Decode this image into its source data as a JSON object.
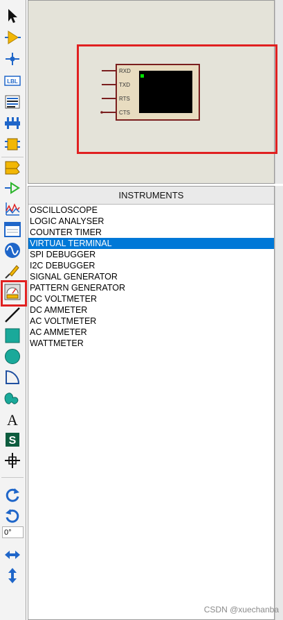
{
  "toolbar": {
    "tools": [
      {
        "name": "selection-tool",
        "icon": "arrow-pointer-icon"
      },
      {
        "name": "component-tool",
        "icon": "component-triangle-icon"
      },
      {
        "name": "junction-dot-tool",
        "icon": "junction-cross-icon"
      },
      {
        "name": "wire-label-tool",
        "icon": "lbl-icon",
        "label": "LBL"
      },
      {
        "name": "text-script-tool",
        "icon": "text-lines-icon"
      },
      {
        "name": "buses-tool",
        "icon": "bus-icon"
      },
      {
        "name": "subcircuit-tool",
        "icon": "subcircuit-icon"
      },
      {
        "name": "terminals-tool",
        "icon": "terminal-icon"
      },
      {
        "name": "device-pins-tool",
        "icon": "pin-icon"
      },
      {
        "name": "graph-tool",
        "icon": "graph-icon"
      },
      {
        "name": "tape-recorder-tool",
        "icon": "tape-icon"
      },
      {
        "name": "generator-tool",
        "icon": "sine-wave-icon"
      },
      {
        "name": "voltage-probe-tool",
        "icon": "probe-icon"
      },
      {
        "name": "virtual-instruments-tool",
        "icon": "meter-gauge-icon"
      },
      {
        "name": "line-tool",
        "icon": "line-icon"
      },
      {
        "name": "box-tool",
        "icon": "box-icon"
      },
      {
        "name": "circle-tool",
        "icon": "circle-icon"
      },
      {
        "name": "arc-tool",
        "icon": "arc-icon"
      },
      {
        "name": "closed-path-tool",
        "icon": "path-icon"
      },
      {
        "name": "text-tool",
        "icon": "text-a-icon",
        "label": "A"
      },
      {
        "name": "symbol-tool",
        "icon": "symbol-s-icon",
        "label": "S"
      },
      {
        "name": "marker-tool",
        "icon": "marker-icon"
      },
      {
        "name": "rotate-clockwise-tool",
        "icon": "rotate-cw-icon"
      },
      {
        "name": "rotate-anticlockwise-tool",
        "icon": "rotate-ccw-icon"
      },
      {
        "name": "mirror-horizontal-tool",
        "icon": "flip-horizontal-icon"
      },
      {
        "name": "mirror-vertical-tool",
        "icon": "flip-vertical-icon"
      }
    ],
    "rotation_value": "0°"
  },
  "preview": {
    "component": "VIRTUAL TERMINAL",
    "pins": [
      "RXD",
      "TXD",
      "RTS",
      "CTS"
    ]
  },
  "instruments": {
    "header": "INSTRUMENTS",
    "items": [
      "OSCILLOSCOPE",
      "LOGIC ANALYSER",
      "COUNTER TIMER",
      "VIRTUAL TERMINAL",
      "SPI DEBUGGER",
      "I2C DEBUGGER",
      "SIGNAL GENERATOR",
      "PATTERN GENERATOR",
      "DC VOLTMETER",
      "DC AMMETER",
      "AC VOLTMETER",
      "AC AMMETER",
      "WATTMETER"
    ],
    "selected": "VIRTUAL TERMINAL"
  },
  "colors": {
    "highlight": "#e02020",
    "selection": "#0078d7",
    "tool_blue": "#1f66c9",
    "tool_yellow": "#f2b705",
    "preview_bg": "#e4e3d9",
    "terminal_screen": "#000000",
    "terminal_led": "#00e000"
  },
  "watermark": "CSDN @xuechanba"
}
